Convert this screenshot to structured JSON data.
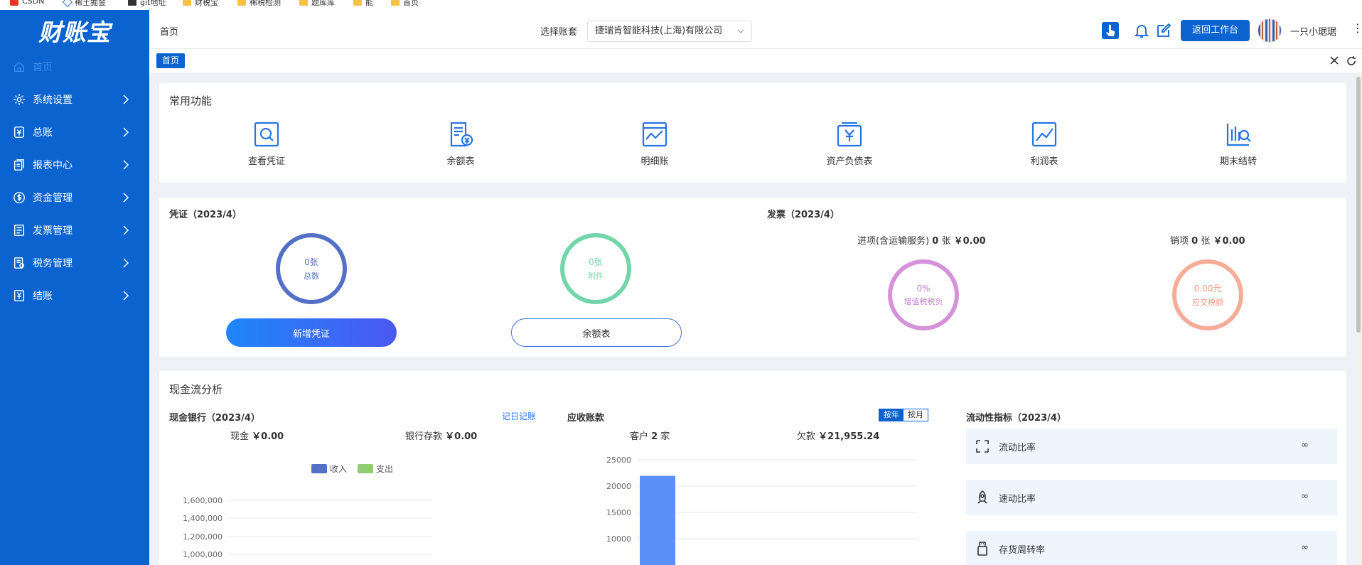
{
  "browser": {
    "bookmarks": [
      "CSDN",
      "稀土掘金",
      "git地址",
      "财税宝",
      "稀税检测",
      "题库库",
      "能",
      "首页"
    ]
  },
  "app": {
    "logo": "财账宝"
  },
  "sidebar": {
    "items": [
      {
        "label": "首页",
        "icon": "home-icon",
        "active": true
      },
      {
        "label": "系统设置",
        "icon": "gear-icon"
      },
      {
        "label": "总账",
        "icon": "ledger-icon"
      },
      {
        "label": "报表中心",
        "icon": "report-icon"
      },
      {
        "label": "资金管理",
        "icon": "money-icon"
      },
      {
        "label": "发票管理",
        "icon": "invoice-icon"
      },
      {
        "label": "税务管理",
        "icon": "tax-icon"
      },
      {
        "label": "结账",
        "icon": "checkout-icon"
      }
    ]
  },
  "header": {
    "breadcrumb": "首页",
    "account_label": "选择账套",
    "account_value": "捷瑞肯智能科技(上海)有限公司",
    "back_button": "返回工作台",
    "username": "一只小琚琚"
  },
  "tabs": {
    "active": "首页"
  },
  "common": {
    "title": "常用功能",
    "items": [
      "查看凭证",
      "余额表",
      "明细账",
      "资产负债表",
      "利润表",
      "期末结转"
    ]
  },
  "voucher": {
    "title": "凭证（2023/4）",
    "total_value": "0张",
    "total_label": "总数",
    "attach_value": "0张",
    "attach_label": "附件",
    "add_button": "新增凭证",
    "balance_button": "余额表"
  },
  "invoice": {
    "title": "发票（2023/4）",
    "input_label": "进项(含运输服务)",
    "input_count": "0",
    "input_unit": "张",
    "input_amount": "￥0.00",
    "output_label": "销项",
    "output_count": "0",
    "output_unit": "张",
    "output_amount": "￥0.00",
    "vat_value": "0%",
    "vat_label": "增值税税负",
    "due_value": "0.00元",
    "due_label": "应交税额"
  },
  "cashflow": {
    "title": "现金流分析",
    "bank": {
      "title": "现金银行（2023/4）",
      "link": "记日记账",
      "cash_label": "现金",
      "cash_value": "￥0.00",
      "deposit_label": "银行存款",
      "deposit_value": "￥0.00"
    },
    "receivable": {
      "title": "应收账款",
      "seg_year": "按年",
      "seg_month": "按月",
      "customer_label": "客户",
      "customer_count": "2",
      "customer_unit": "家",
      "debt_label": "欠款",
      "debt_value": "￥21,955.24"
    },
    "liquidity": {
      "title": "流动性指标（2023/4）",
      "items": [
        {
          "label": "流动比率",
          "value": "∞"
        },
        {
          "label": "速动比率",
          "value": "∞"
        },
        {
          "label": "存货周转率",
          "value": "∞"
        }
      ]
    }
  },
  "chart_data": [
    {
      "type": "bar",
      "title": "",
      "legend": [
        "收入",
        "支出"
      ],
      "y_ticks": [
        "1,600,000",
        "1,400,000",
        "1,200,000",
        "1,000,000"
      ],
      "series": [
        {
          "name": "收入",
          "values": []
        },
        {
          "name": "支出",
          "values": []
        }
      ],
      "colors": [
        "#5470c6",
        "#91cc75"
      ]
    },
    {
      "type": "bar",
      "title": "",
      "y_ticks": [
        "25000",
        "20000",
        "15000",
        "10000"
      ],
      "categories": [
        ""
      ],
      "values": [
        21955.24
      ],
      "ylim": [
        0,
        25000
      ],
      "color": "#5b8ff9"
    }
  ],
  "colors": {
    "brand": "#0a63ce",
    "ring_total": "#5470c6",
    "ring_attach": "#73d6ab",
    "ring_vat": "#d592d8",
    "ring_due": "#f6ad97"
  }
}
